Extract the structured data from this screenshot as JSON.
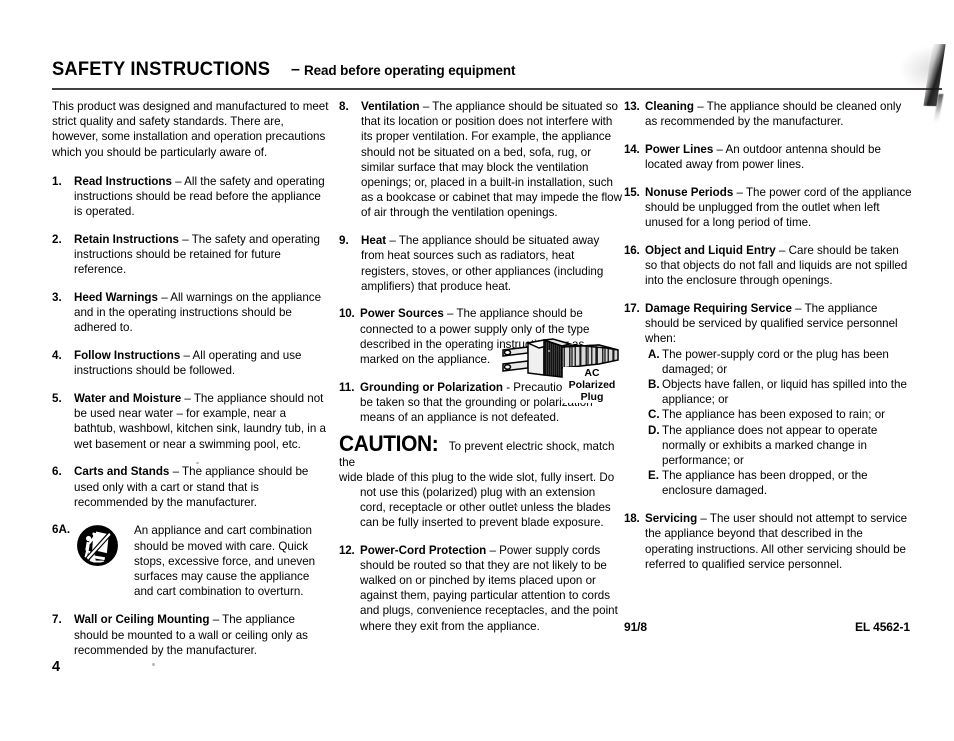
{
  "header": {
    "title": "SAFETY INSTRUCTIONS",
    "dash": "–",
    "subtitle": "Read before operating equipment"
  },
  "intro": "This product was designed and manufactured to meet strict quality and safety standards. There are, however, some installation and operation precautions which you should be particularly aware of.",
  "column1": [
    {
      "num": "1.",
      "title": "Read Instructions",
      "text": " – All the safety and operating instructions should be read before the appliance is operated."
    },
    {
      "num": "2.",
      "title": "Retain Instructions",
      "text": " – The safety and operating instructions should be retained for future reference."
    },
    {
      "num": "3.",
      "title": "Heed Warnings",
      "text": " – All warnings on the appliance and in the operating instructions should be adhered to."
    },
    {
      "num": "4.",
      "title": "Follow Instructions",
      "text": " – All operating and use instructions should be followed."
    },
    {
      "num": "5.",
      "title": "Water and Moisture",
      "text": " – The appliance should not be used near water – for example, near a bathtub, washbowl, kitchen sink, laundry tub, in a wet basement or near a swimming pool, etc."
    },
    {
      "num": "6.",
      "title": "Carts and Stands",
      "text": " – The appliance should be used only with a cart or stand that is recommended by the manufacturer."
    }
  ],
  "item6a": {
    "num": "6A.",
    "icon": "cart-warning-icon",
    "text": "An appliance and cart combination should be moved with care. Quick stops, excessive force, and uneven surfaces may cause the appliance and cart combination to overturn."
  },
  "item7": {
    "num": "7.",
    "title": "Wall or Ceiling Mounting",
    "text": " – The appliance should be mounted to a wall or ceiling only as recommended by the manufacturer."
  },
  "column2": [
    {
      "num": "8.",
      "title": "Ventilation",
      "text": " – The appliance should be situated so that its location or position does not interfere with its proper ventilation. For example, the appliance should not be situated on a bed, sofa, rug, or similar surface that may block the ventilation openings; or, placed in a built-in installation, such as a bookcase or cabinet that may impede the flow of air through the ventilation openings."
    },
    {
      "num": "9.",
      "title": "Heat",
      "text": " – The appliance should be situated away from heat sources such as radiators, heat registers, stoves, or other appliances (including amplifiers) that produce heat."
    },
    {
      "num": "10.",
      "title": "Power Sources",
      "text": " – The appliance should be connected to a power supply only of the type described in the operating instructions or as marked on the appliance."
    }
  ],
  "item11": {
    "num": "11.",
    "title": "Grounding or Polarization",
    "text": " - Precautions should be taken so that the grounding or polarization means of an appliance is not defeated."
  },
  "plug_figure": {
    "icon": "ac-polarized-plug-icon",
    "caption_line1": "AC",
    "caption_line2": "Polarized Plug"
  },
  "caution": {
    "word": "CAUTION:",
    "text_first": " To prevent electric shock, match the",
    "text_rest": "wide blade of this plug to the wide slot, fully insert. Do not use this (polarized) plug with an extension cord, receptacle or other outlet unless the blades can be fully inserted to prevent blade exposure."
  },
  "item12": {
    "num": "12.",
    "title": "Power-Cord Protection",
    "text": " – Power supply cords should be routed so that they are not likely to be walked on or pinched by items placed upon or against them, paying particular attention to cords and plugs, convenience receptacles, and the point where they exit from the appliance."
  },
  "column3": [
    {
      "num": "13.",
      "title": "Cleaning",
      "text": " – The appliance should be cleaned only as recommended by the manufacturer."
    },
    {
      "num": "14.",
      "title": "Power Lines",
      "text": " – An outdoor antenna should be located away from power lines."
    },
    {
      "num": "15.",
      "title": "Nonuse Periods",
      "text": " – The power cord of the appliance should be unplugged from the outlet when left unused for a long period of time."
    },
    {
      "num": "16.",
      "title": "Object and Liquid Entry",
      "text": " – Care should be taken so that objects do not fall and liquids are not spilled into the enclosure through openings."
    }
  ],
  "item17": {
    "num": "17.",
    "title": "Damage Requiring Service",
    "text": " – The appliance should be serviced by qualified service personnel when:",
    "subitems": [
      {
        "letter": "A.",
        "text": "The power-supply cord or the plug has been damaged; or"
      },
      {
        "letter": "B.",
        "text": "Objects have fallen, or liquid has spilled into the appliance; or"
      },
      {
        "letter": "C.",
        "text": "The appliance has been exposed to rain; or"
      },
      {
        "letter": "D.",
        "text": "The appliance does not appear to operate normally or exhibits a marked change in performance; or"
      },
      {
        "letter": "E.",
        "text": "The appliance has been dropped, or the enclosure damaged."
      }
    ]
  },
  "item18": {
    "num": "18.",
    "title": "Servicing",
    "text": " – The user should not attempt to service the appliance beyond that described in the operating instructions. All other servicing should be referred to qualified service personnel."
  },
  "footer": {
    "left_code": "91/8",
    "right_code": "EL 4562-1",
    "page_number": "4"
  },
  "colors": {
    "ink": "#000000",
    "paper": "#ffffff",
    "rule": "#231f20"
  }
}
